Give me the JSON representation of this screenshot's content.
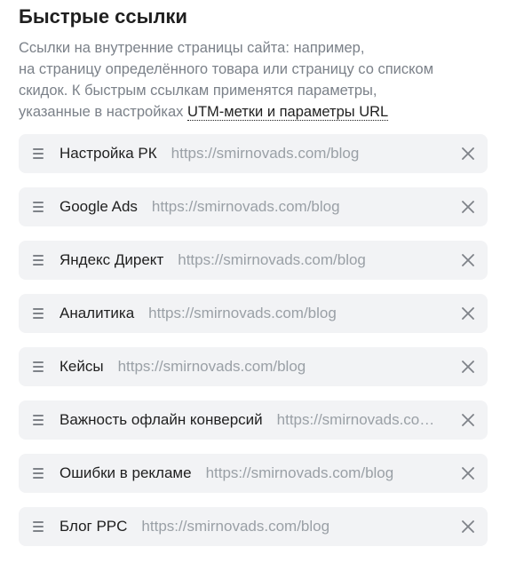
{
  "title": "Быстрые ссылки",
  "description": {
    "line1": "Ссылки на внутренние страницы сайта: например,",
    "line2": "на страницу определённого товара или страницу со списком",
    "line3": "скидок. К быстрым ссылкам применятся параметры,",
    "line4_prefix": "указанные в настройках ",
    "link": "UTM-метки и параметры URL"
  },
  "links": [
    {
      "name": "Настройка РК",
      "url": "https://smirnovads.com/blog"
    },
    {
      "name": "Google Ads",
      "url": "https://smirnovads.com/blog"
    },
    {
      "name": "Яндекс Директ",
      "url": "https://smirnovads.com/blog"
    },
    {
      "name": "Аналитика",
      "url": "https://smirnovads.com/blog"
    },
    {
      "name": "Кейсы",
      "url": "https://smirnovads.com/blog"
    },
    {
      "name": "Важность офлайн конверсий",
      "url": "https://smirnovads.com/blog"
    },
    {
      "name": "Ошибки в рекламе",
      "url": "https://smirnovads.com/blog"
    },
    {
      "name": "Блог PPC",
      "url": "https://smirnovads.com/blog"
    }
  ],
  "icons": {
    "drag": "drag-handle-icon",
    "remove": "close-icon"
  },
  "colors": {
    "row_background": "#f2f3f5",
    "text_primary": "#1f1f1f",
    "text_secondary": "#7b8189",
    "url_text": "#9aa0a6",
    "icon": "#7f8389"
  }
}
